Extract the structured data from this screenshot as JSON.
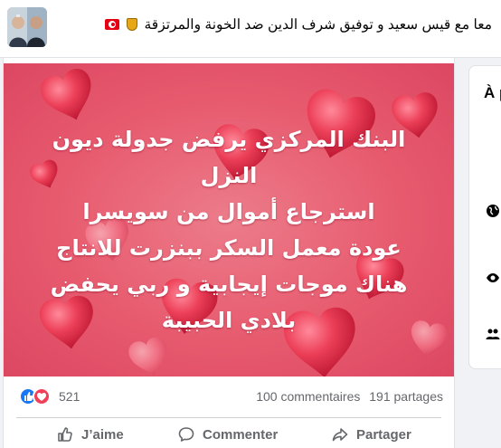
{
  "group": {
    "title": "معا مع قيس سعيد و توفيق شرف الدين ضد الخونة والمرتزقة",
    "avatar_icon": "group-avatar",
    "flag_icon": "tunisia-flag-icon",
    "badge_icon": "shield-icon"
  },
  "post": {
    "image_lines": [
      "البنك المركزي يرفض جدولة ديون",
      "النزل",
      "استرجاع أموال من سويسرا",
      "عودة معمل السكر ببنزرت للانتاج",
      "هناك موجات إيجابية و ربي يحفض",
      "بلادي الحبيبة"
    ],
    "image_colors": {
      "background": "#e75a6e",
      "heart": "#ea3f56",
      "text": "#ffffff"
    },
    "reactions_count": "521",
    "comments": "100 commentaires",
    "shares": "191 partages",
    "actions": {
      "like": "J’aime",
      "comment": "Commenter",
      "share": "Partager"
    }
  },
  "side_panel": {
    "title": "À p",
    "icons": [
      "globe-icon",
      "eye-icon",
      "people-icon"
    ]
  },
  "colors": {
    "like_blue": "#1877f2",
    "love_red": "#f33e58",
    "muted_text": "#65676b"
  }
}
